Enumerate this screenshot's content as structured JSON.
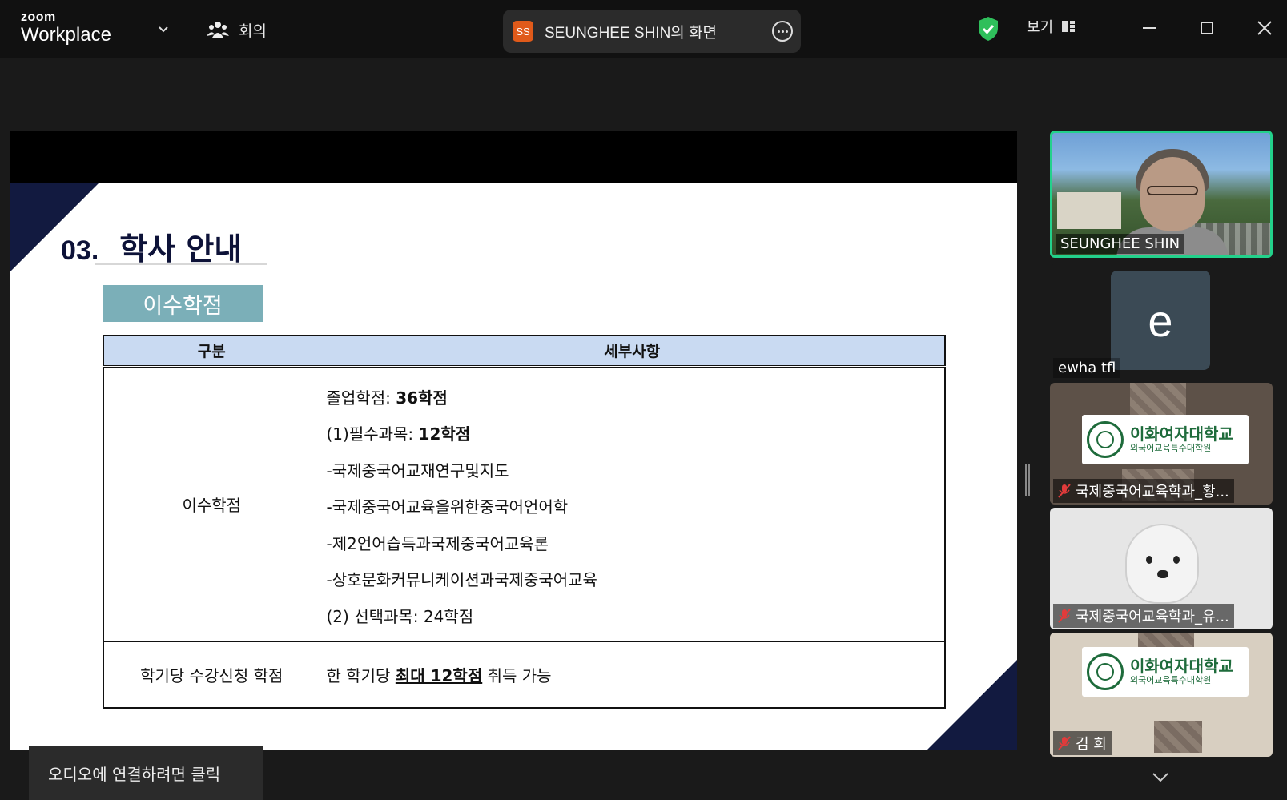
{
  "app": {
    "logo_top": "zoom",
    "logo_bottom": "Workplace"
  },
  "toolbar": {
    "meeting_label": "회의",
    "share_badge": "SS",
    "share_label": "SEUNGHEE SHIN의 화면",
    "view_label": "보기"
  },
  "slide": {
    "section_number": "03.",
    "section_title": "학사 안내",
    "tag": "이수학점",
    "table": {
      "headers": [
        "구분",
        "세부사항"
      ],
      "row1_label": "이수학점",
      "row1_details": {
        "graduation_prefix": "졸업학점: ",
        "graduation_value": "36학점",
        "required_prefix": "(1)필수과목: ",
        "required_value": "12학점",
        "course1": "-국제중국어교재연구및지도",
        "course2": "-국제중국어교육을위한중국어언어학",
        "course3": "-제2언어습득과국제중국어교육론",
        "course4": "-상호문화커뮤니케이션과국제중국어교육",
        "elective": "(2) 선택과목: 24학점"
      },
      "row2_label": "학기당 수강신청 학점",
      "row2_prefix": "한 학기당 ",
      "row2_emphasis": "최대 12학점",
      "row2_suffix": " 취득 가능"
    }
  },
  "audio_bar": {
    "label": "오디오에 연결하려면 클릭"
  },
  "participants": [
    {
      "name": "SEUNGHEE SHIN"
    },
    {
      "name": "ewha tfl",
      "avatar_letter": "e"
    },
    {
      "name": "국제중국어교육학과_황...",
      "logo_main": "이화여자대학교",
      "logo_sub": "외국어교육특수대학원"
    },
    {
      "name": "국제중국어교육학과_유..."
    },
    {
      "name": "김  희",
      "logo_main": "이화여자대학교",
      "logo_sub": "외국어교육특수대학원"
    }
  ],
  "colors": {
    "accent_green": "#23d18b",
    "share_badge": "#e05a1a",
    "slide_navy": "#121a40",
    "tag_teal": "#7bafb8",
    "table_header": "#c9daf2",
    "ewha_green": "#1e6b3b"
  }
}
